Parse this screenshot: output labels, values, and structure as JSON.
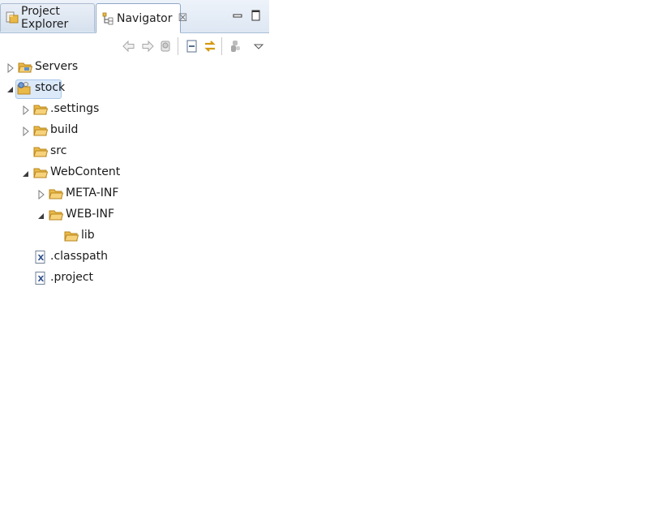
{
  "tabs": [
    {
      "label": "Project Explorer",
      "icon": "project-explorer-icon",
      "active": false
    },
    {
      "label": "Navigator",
      "icon": "navigator-icon",
      "active": true
    }
  ],
  "close_glyph": "☒",
  "toolbar": [
    "back-icon",
    "forward-icon",
    "go-into-icon",
    "collapse-all-icon",
    "link-with-editor-icon",
    "working-sets-icon",
    "view-menu-icon"
  ],
  "tree": [
    {
      "label": "Servers",
      "icon": "folder-icon",
      "expanded": false
    },
    {
      "label": "stock",
      "icon": "project-icon",
      "expanded": true,
      "selected": true
    },
    {
      "label": ".settings",
      "icon": "folder-icon",
      "expanded": false
    },
    {
      "label": "build",
      "icon": "folder-icon",
      "expanded": false
    },
    {
      "label": "src",
      "icon": "folder-icon"
    },
    {
      "label": "WebContent",
      "icon": "folder-icon",
      "expanded": true
    },
    {
      "label": "META-INF",
      "icon": "folder-icon",
      "expanded": false
    },
    {
      "label": "WEB-INF",
      "icon": "folder-icon",
      "expanded": true
    },
    {
      "label": "lib",
      "icon": "folder-icon"
    },
    {
      "label": ".classpath",
      "icon": "xml-file-icon"
    },
    {
      "label": ".project",
      "icon": "xml-file-icon"
    }
  ],
  "colors": {
    "folder": "#e9b949",
    "folder_dark": "#c58f1c",
    "selection": "#dbe9f9",
    "tab_border": "#8fa8c6"
  }
}
